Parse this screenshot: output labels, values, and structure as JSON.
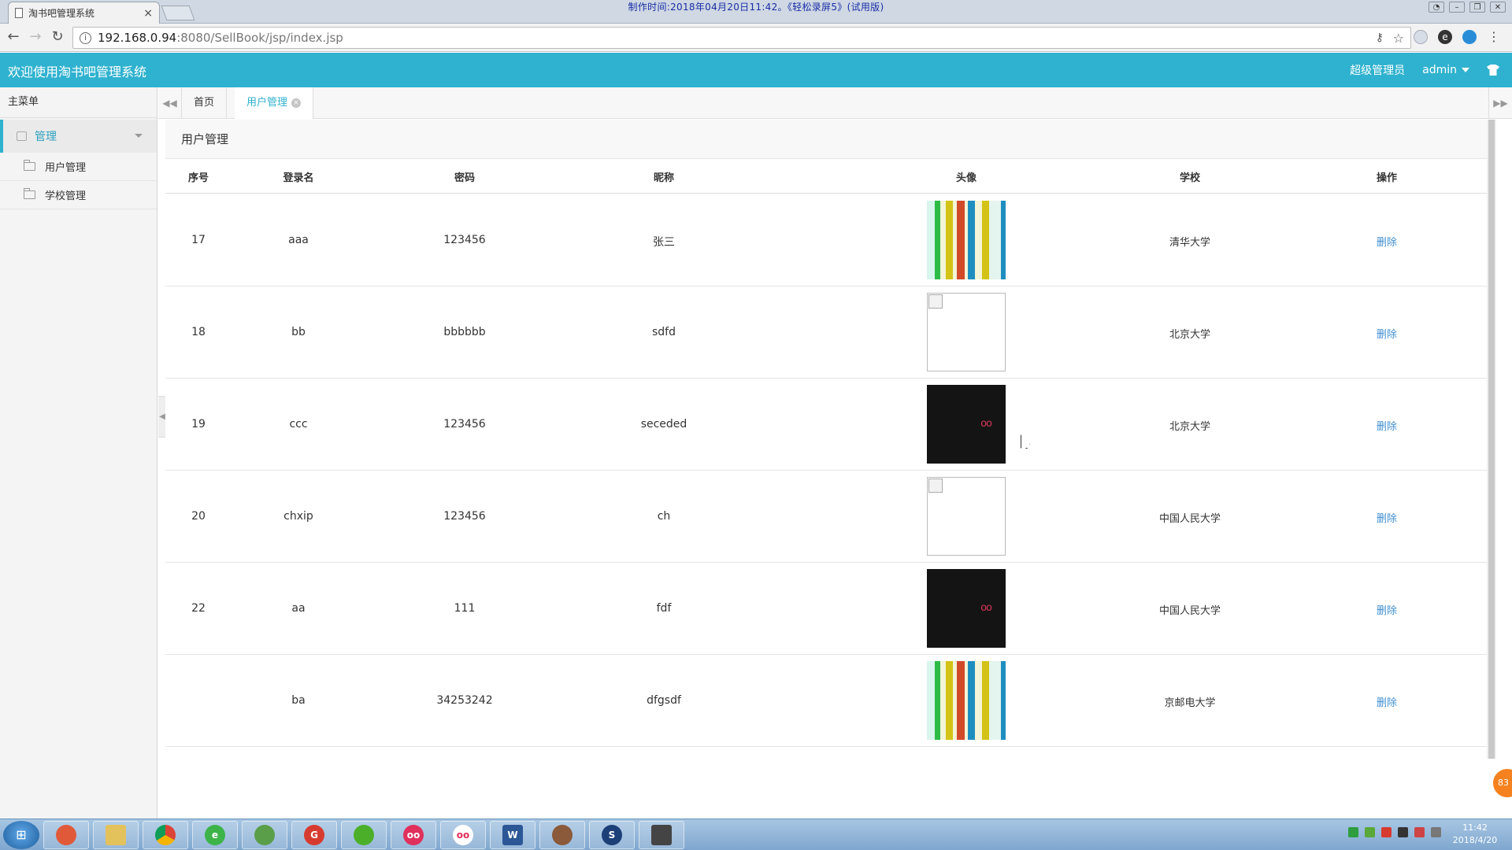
{
  "browser": {
    "tab_title": "淘书吧管理系统",
    "tab_close": "×",
    "watermark": "制作时间:2018年04月20日11:42。《轻松录屏5》(试用版)",
    "url_host": "192.168.0.94",
    "url_path": ":8080/SellBook/jsp/index.jsp",
    "info_icon": "i",
    "back_icon": "←",
    "forward_icon": "→",
    "reload_icon": "↻",
    "key_icon": "⚷",
    "star_icon": "☆",
    "menu_icon": "⋮"
  },
  "header": {
    "title": "欢迎使用淘书吧管理系统",
    "role": "超级管理员",
    "user": "admin"
  },
  "sidebar": {
    "heading": "主菜单",
    "group_label": "管理",
    "items": [
      {
        "label": "用户管理"
      },
      {
        "label": "学校管理"
      }
    ]
  },
  "tabs": {
    "home": "首页",
    "active": "用户管理",
    "close": "×",
    "prev": "◀◀",
    "next": "▶▶"
  },
  "panel": {
    "title": "用户管理"
  },
  "table": {
    "columns": [
      "序号",
      "登录名",
      "密码",
      "昵称",
      "头像",
      "学校",
      "操作"
    ],
    "rows": [
      {
        "id": "17",
        "login": "aaa",
        "password": "123456",
        "nickname": "张三",
        "avatar": "bars",
        "school": "清华大学",
        "action": "删除"
      },
      {
        "id": "18",
        "login": "bb",
        "password": "bbbbbb",
        "nickname": "sdfd",
        "avatar": "broken",
        "school": "北京大学",
        "action": "删除"
      },
      {
        "id": "19",
        "login": "ccc",
        "password": "123456",
        "nickname": "seceded",
        "avatar": "dark",
        "avatar_text": "oo",
        "school": "北京大学",
        "action": "删除"
      },
      {
        "id": "20",
        "login": "chxip",
        "password": "123456",
        "nickname": "ch",
        "avatar": "broken",
        "school": "中国人民大学",
        "action": "删除"
      },
      {
        "id": "22",
        "login": "aa",
        "password": "111",
        "nickname": "fdf",
        "avatar": "dark",
        "avatar_text": "oo",
        "school": "中国人民大学",
        "action": "删除"
      },
      {
        "id": "",
        "login": "ba",
        "password": "34253242",
        "nickname": "dfgsdf",
        "avatar": "bars",
        "school": "京邮电大学",
        "action": "删除"
      }
    ]
  },
  "badge": "83",
  "taskbar": {
    "time": "11:42",
    "date": "2018/4/20",
    "apps": [
      "start",
      "photos",
      "explorer",
      "chrome",
      "ie-green",
      "android",
      "foxit",
      "leaf",
      "recorder",
      "oo",
      "word",
      "avatar-app",
      "s-app",
      "presentation"
    ]
  },
  "colors": {
    "header": "#2fb2cf",
    "link": "#3f8fd2",
    "active_tab": "#2fb2cf"
  }
}
